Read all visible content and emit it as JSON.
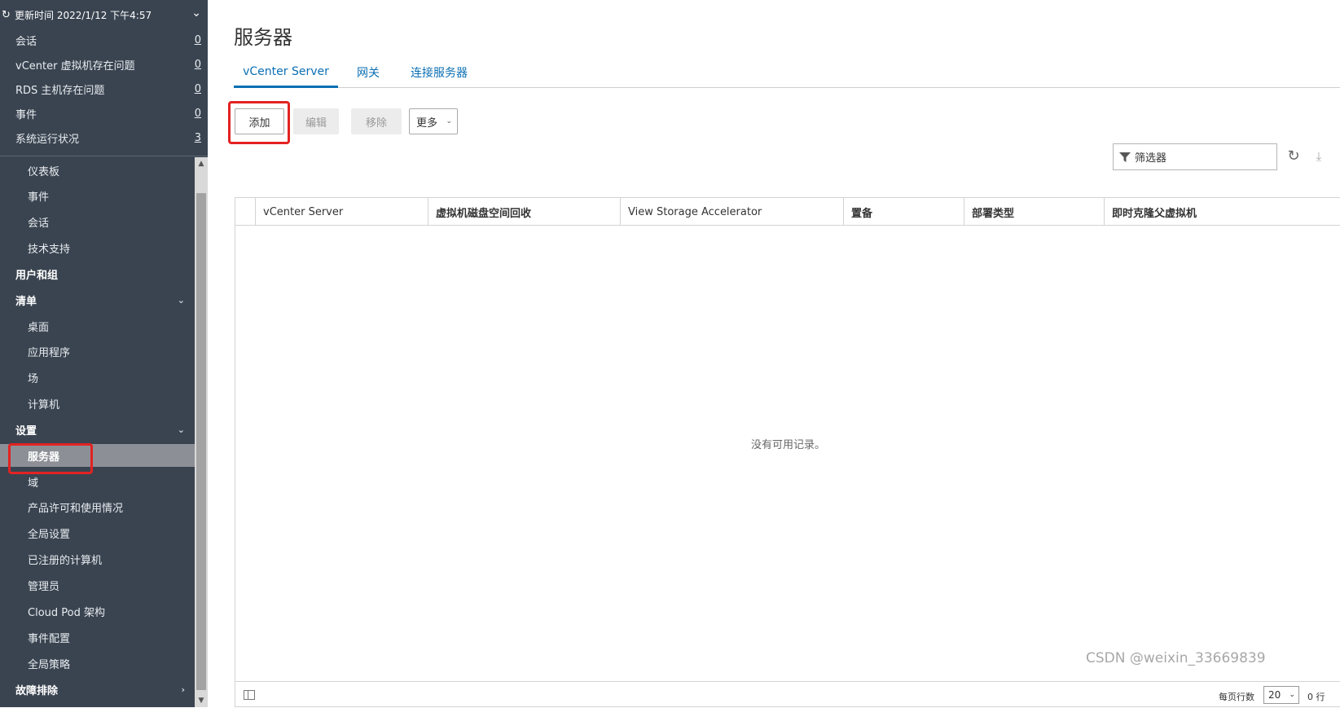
{
  "sidebar": {
    "update_text": "更新时间 2022/1/12 下午4:57",
    "summary": [
      {
        "label": "会话",
        "count": "0"
      },
      {
        "label": "vCenter 虚拟机存在问题",
        "count": "0"
      },
      {
        "label": "RDS 主机存在问题",
        "count": "0"
      },
      {
        "label": "事件",
        "count": "0"
      },
      {
        "label": "系统运行状况",
        "count": "3"
      }
    ],
    "monitor_items": [
      "仪表板",
      "事件",
      "会话",
      "技术支持"
    ],
    "users_groups": "用户和组",
    "inventory": {
      "label": "清单",
      "items": [
        "桌面",
        "应用程序",
        "场",
        "计算机"
      ]
    },
    "settings": {
      "label": "设置",
      "items": [
        "服务器",
        "域",
        "产品许可和使用情况",
        "全局设置",
        "已注册的计算机",
        "管理员",
        "Cloud Pod 架构",
        "事件配置",
        "全局策略"
      ]
    },
    "troubleshoot": "故障排除"
  },
  "main": {
    "title": "服务器",
    "tabs": [
      "vCenter Server",
      "网关",
      "连接服务器"
    ],
    "toolbar": {
      "add": "添加",
      "edit": "编辑",
      "remove": "移除",
      "more": "更多"
    },
    "filter_placeholder": "筛选器",
    "columns": [
      "vCenter Server",
      "虚拟机磁盘空间回收",
      "View Storage Accelerator",
      "置备",
      "部署类型",
      "即时克隆父虚拟机"
    ],
    "empty_message": "没有可用记录。",
    "footer": {
      "rows_per_page_label": "每页行数",
      "rows_per_page": "20",
      "row_count": "0 行"
    }
  },
  "watermark": "CSDN @weixin_33669839",
  "colors": {
    "sidebar_bg": "#3a4451",
    "active_item": "#8c9096",
    "accent": "#0b6fb3",
    "highlight": "#e32222"
  }
}
